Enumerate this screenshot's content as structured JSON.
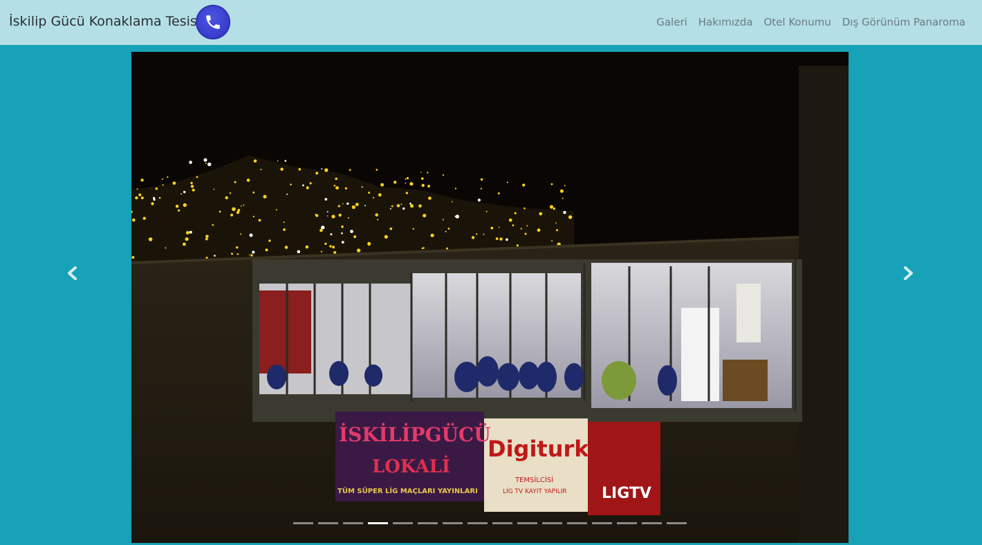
{
  "navbar": {
    "brand": "İskilip Gücü Konaklama Tesisi",
    "phone_icon": "phone-icon",
    "links": [
      "Galeri",
      "Hakımızda",
      "Otel Konumu",
      "Dış Görünüm Panaroma"
    ]
  },
  "carousel": {
    "active_index": 3,
    "slide_count": 16,
    "prev_icon": "chevron-left-icon",
    "next_icon": "chevron-right-icon",
    "banner": {
      "left_line1": "İSKİLİPGÜCÜ",
      "left_line2": "LOKALİ",
      "left_line3": "TÜM SÜPER LİG MAÇLARI YAYINLARI",
      "middle_brand": "Digiturk",
      "middle_sub1": "TEMSİLCİSİ",
      "middle_sub2": "LİG TV KAYIT YAPILIR",
      "right_brand": "LIGTV"
    }
  },
  "colors": {
    "page_bg": "#17a2b8",
    "navbar_bg": "#b4dfe6",
    "phone_button": "#3a3fcf"
  }
}
